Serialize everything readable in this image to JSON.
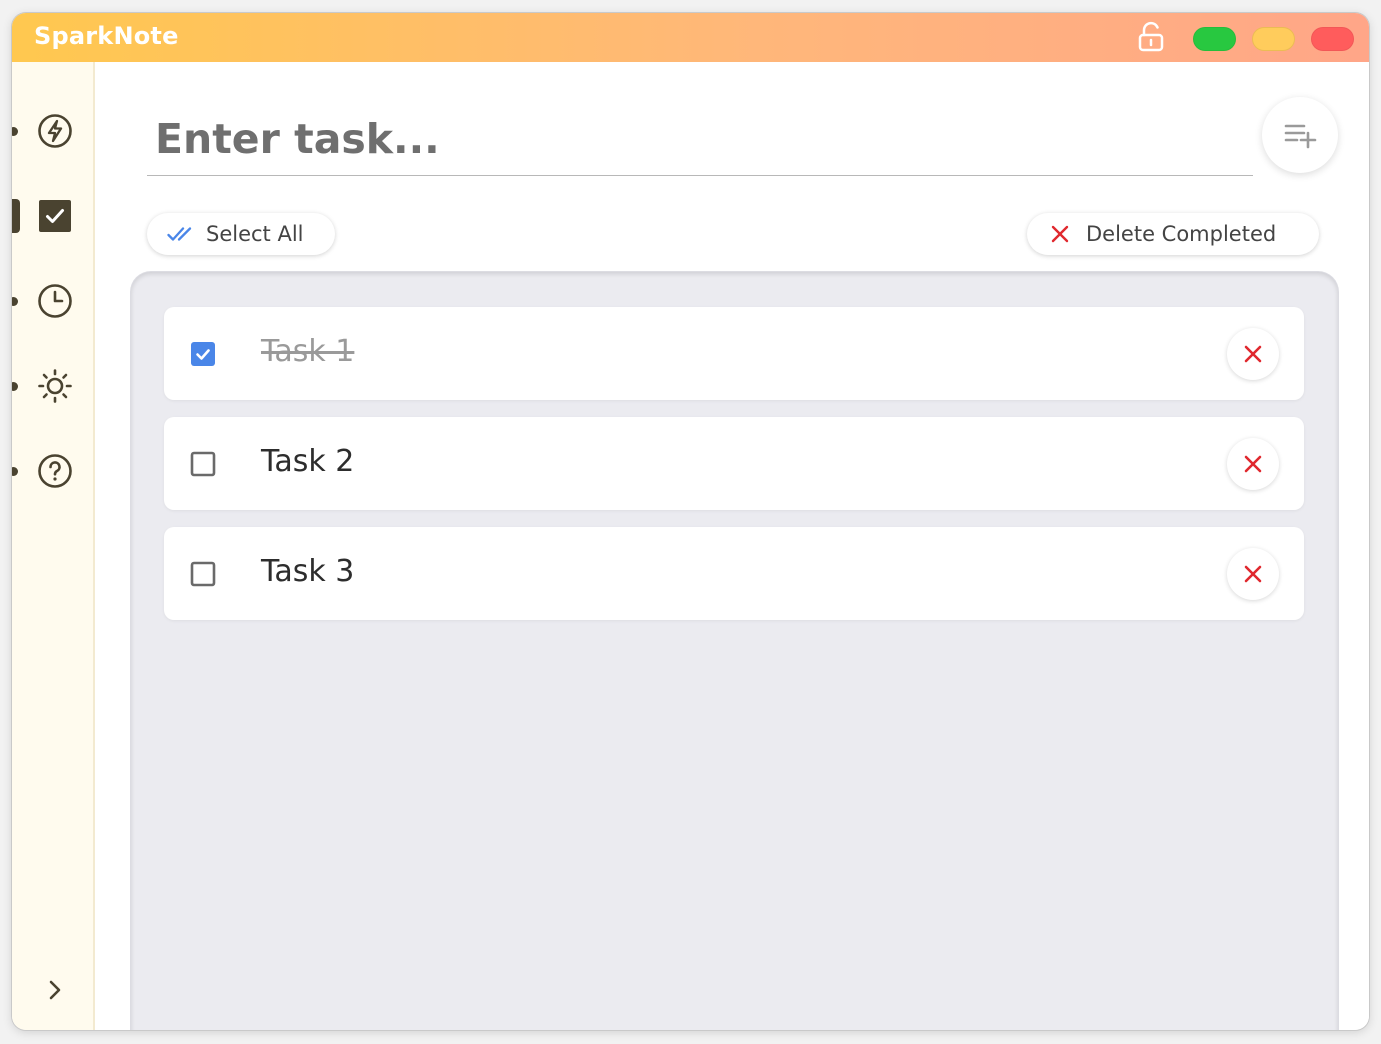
{
  "window": {
    "title": "SparkNote",
    "controls": [
      "maximize",
      "minimize",
      "close"
    ],
    "colors": {
      "green": "#28c840",
      "yellow": "#ffcc5c",
      "red": "#ff5c5c"
    }
  },
  "sidebar": {
    "items": [
      {
        "id": "quick",
        "icon": "lightning-icon",
        "active": false
      },
      {
        "id": "tasks",
        "icon": "checkbox-icon",
        "active": true
      },
      {
        "id": "history",
        "icon": "clock-icon",
        "active": false
      },
      {
        "id": "theme",
        "icon": "sun-icon",
        "active": false
      },
      {
        "id": "help",
        "icon": "help-icon",
        "active": false
      }
    ],
    "expand_icon": "chevron-right-icon"
  },
  "input": {
    "placeholder": "Enter task...",
    "value": ""
  },
  "toolbar": {
    "select_all_label": "Select All",
    "delete_completed_label": "Delete Completed"
  },
  "tasks": [
    {
      "text": "Task 1",
      "done": true
    },
    {
      "text": "Task 2",
      "done": false
    },
    {
      "text": "Task 3",
      "done": false
    }
  ],
  "colors": {
    "accent_blue": "#4a86e8",
    "delete_red": "#e0282e",
    "sidebar_icon": "#4a4330"
  }
}
